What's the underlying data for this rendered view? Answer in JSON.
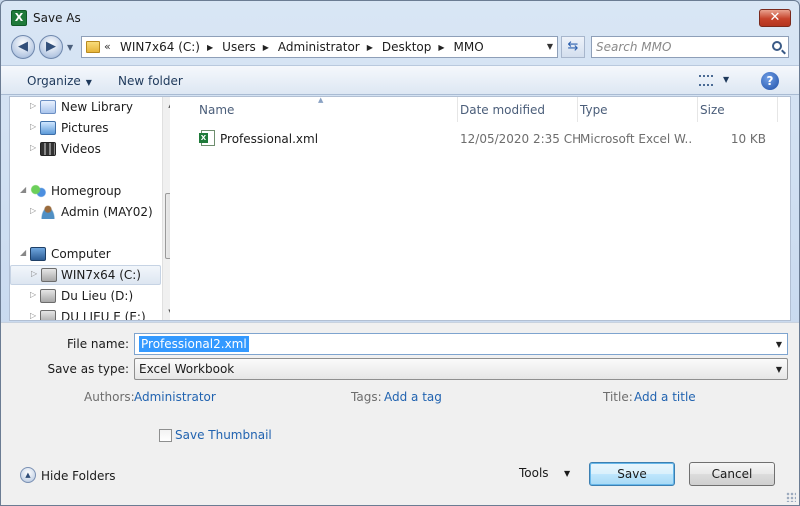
{
  "window": {
    "title": "Save As",
    "app_icon": "excel-icon",
    "close_label": "✕"
  },
  "nav": {
    "back_glyph": "◀",
    "forward_glyph": "▶",
    "overflow_glyph": "«",
    "path": [
      "WIN7x64 (C:)",
      "Users",
      "Administrator",
      "Desktop",
      "MMO"
    ],
    "separator_glyph": "▶",
    "search_placeholder": "Search MMO",
    "refresh_glyph": "⇆"
  },
  "toolbar": {
    "organize_label": "Organize",
    "new_folder_label": "New folder",
    "help_label": "?"
  },
  "tree": {
    "items": [
      {
        "label": "New Library",
        "icon": "library-icon",
        "expander": "▷"
      },
      {
        "label": "Pictures",
        "icon": "pictures-icon",
        "expander": "▷"
      },
      {
        "label": "Videos",
        "icon": "videos-icon",
        "expander": "▷"
      },
      {
        "label": "Homegroup",
        "icon": "homegroup-icon",
        "expander": "◢"
      },
      {
        "label": "Admin (MAY02)",
        "icon": "user-icon",
        "expander": "▷"
      },
      {
        "label": "Computer",
        "icon": "computer-icon",
        "expander": "◢"
      },
      {
        "label": "WIN7x64 (C:)",
        "icon": "drive-icon",
        "expander": "▷",
        "selected": true
      },
      {
        "label": "Du Lieu (D:)",
        "icon": "drive-icon",
        "expander": "▷"
      },
      {
        "label": "DU LIEU E (E:)",
        "icon": "drive-icon",
        "expander": "▷"
      }
    ]
  },
  "columns": {
    "name": "Name",
    "date": "Date modified",
    "type": "Type",
    "size": "Size"
  },
  "files": [
    {
      "name": "Professional.xml",
      "date": "12/05/2020 2:35 CH",
      "type": "Microsoft Excel W...",
      "size": "10 KB"
    }
  ],
  "form": {
    "file_name_label": "File name:",
    "file_name_value": "Professional2.xml",
    "save_type_label": "Save as type:",
    "save_type_value": "Excel Workbook",
    "authors_label": "Authors:",
    "authors_value": "Administrator",
    "tags_label": "Tags:",
    "tags_value": "Add a tag",
    "title_label": "Title:",
    "title_value": "Add a title",
    "thumbnail_label": "Save Thumbnail",
    "thumbnail_checked": false
  },
  "footer": {
    "hide_folders_label": "Hide Folders",
    "tools_label": "Tools",
    "save_label": "Save",
    "cancel_label": "Cancel"
  }
}
